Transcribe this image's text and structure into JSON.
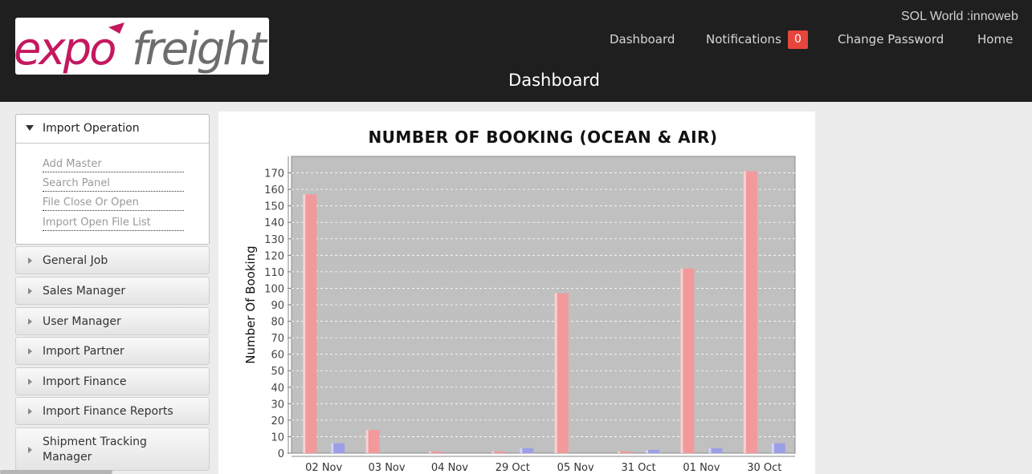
{
  "header": {
    "logo": {
      "part1": "expo",
      "part2": "freight"
    },
    "user_text": "SOL World :innoweb",
    "nav": [
      {
        "label": "Dashboard"
      },
      {
        "label": "Notifications"
      },
      {
        "label": "Change Password"
      },
      {
        "label": "Home"
      }
    ],
    "notification_count": "0",
    "page_title": "Dashboard"
  },
  "sidebar": {
    "open_section": {
      "label": "Import Operation",
      "links": [
        {
          "label": "Add Master"
        },
        {
          "label": "Search Panel"
        },
        {
          "label": "File Close Or Open"
        },
        {
          "label": "Import Open File List"
        }
      ]
    },
    "sections": [
      {
        "label": "General Job"
      },
      {
        "label": "Sales Manager"
      },
      {
        "label": "User Manager"
      },
      {
        "label": "Import Partner"
      },
      {
        "label": "Import Finance"
      },
      {
        "label": "Import Finance Reports"
      },
      {
        "label": "Shipment Tracking Manager"
      }
    ]
  },
  "colors": {
    "header_bg": "#1f1f1f",
    "badge": "#e8453c",
    "logo_pink": "#c4185f",
    "logo_gray": "#6d6d6d",
    "ocean_bar": "#f2999b",
    "air_bar": "#9b9fe6",
    "plot_bg": "#c0c0c0"
  },
  "chart_data": {
    "type": "bar",
    "title": "NUMBER OF BOOKING (OCEAN & AIR)",
    "xlabel": "",
    "ylabel": "Number Of Booking",
    "ylim": [
      0,
      180
    ],
    "yticks": [
      0,
      10,
      20,
      30,
      40,
      50,
      60,
      70,
      80,
      90,
      100,
      110,
      120,
      130,
      140,
      150,
      160,
      170
    ],
    "grid": true,
    "legend": "none",
    "categories": [
      "02 Nov",
      "03 Nov",
      "04 Nov",
      "29 Oct",
      "05 Nov",
      "31 Oct",
      "01 Nov",
      "30 Oct"
    ],
    "series": [
      {
        "values": [
          157,
          14,
          1,
          1,
          97,
          1,
          112,
          171
        ]
      },
      {
        "values": [
          6,
          0,
          0,
          3,
          0,
          2,
          3,
          6
        ]
      }
    ]
  }
}
